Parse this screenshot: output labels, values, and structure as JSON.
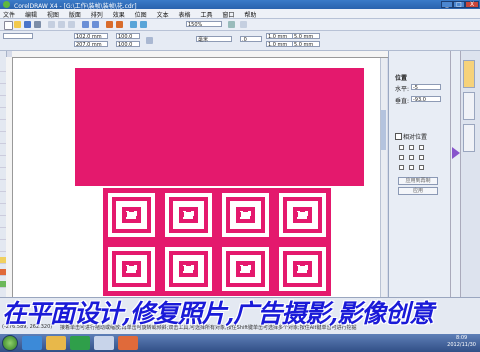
{
  "window": {
    "title": "CorelDRAW X4 - [G:\\工作\\装帧\\装帧\\花.cdr]",
    "minimize": "_",
    "maximize": "□",
    "close": "X"
  },
  "menu": [
    "文件",
    "编辑",
    "视图",
    "版面",
    "排列",
    "效果",
    "位图",
    "文本",
    "表格",
    "工具",
    "窗口",
    "帮助"
  ],
  "propbar": {
    "width": "102.0 mm",
    "height": "207.0 mm",
    "scale_x": "100.0",
    "scale_y": "100.0",
    "zoom": "150%",
    "units": "毫米",
    "angle": ".0",
    "nudge_a": "1.0 mm",
    "nudge_b": "1.0 mm",
    "dup_x": "5.0 mm",
    "dup_y": "5.0 mm"
  },
  "docker": {
    "title": "位置",
    "x_label": "水平:",
    "x_value": "-5",
    "y_label": "垂直:",
    "y_value": "-93.0",
    "relative_label": "相对位置",
    "apply_copy": "应用到再制",
    "apply": "应用"
  },
  "colors": {
    "accent": "#e4196d",
    "banner_text": "#1a1ad8",
    "canvas": "#ffffff",
    "titlebar": "#2a63ad"
  },
  "pattern": {
    "columns": 4,
    "rows": 2
  },
  "status": {
    "coords": "(-276.589, 262.320)",
    "hint": "接着单击可进行拖动或缩放;再单击可旋转或倾斜;双击工具,可选择所有对象;按住Shift键单击可选择多个对象;按住Alt键单击可进行挖掘"
  },
  "banner": "在平面设计,修复照片,广告摄影,影像创意",
  "taskbar": {
    "time": "8:09",
    "date": "2012/11/30"
  }
}
